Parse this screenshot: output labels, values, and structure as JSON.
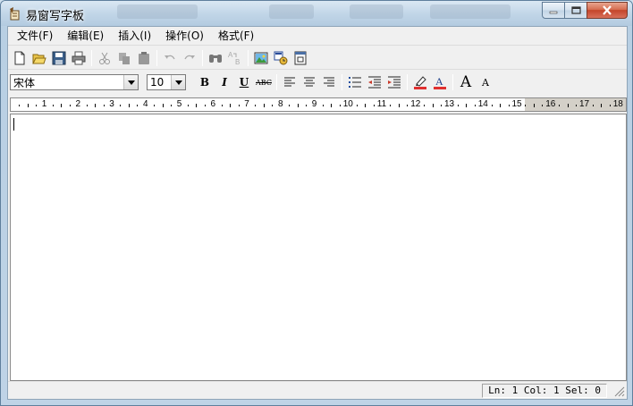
{
  "window": {
    "title": "易窗写字板",
    "controls": {
      "minimize_icon": "minimize-icon",
      "maximize_icon": "maximize-icon",
      "close_icon": "close-icon"
    }
  },
  "menu": [
    {
      "id": "file",
      "label": "文件(F)"
    },
    {
      "id": "edit",
      "label": "编辑(E)"
    },
    {
      "id": "insert",
      "label": "插入(I)"
    },
    {
      "id": "operate",
      "label": "操作(O)"
    },
    {
      "id": "format",
      "label": "格式(F)"
    }
  ],
  "toolbar_standard": [
    "new-document-icon",
    "open-folder-icon",
    "save-icon",
    "print-icon",
    "cut-icon",
    "copy-icon",
    "paste-icon",
    "undo-icon",
    "redo-icon",
    "find-icon",
    "replace-icon",
    "insert-picture-icon",
    "insert-object-icon",
    "insert-datetime-icon"
  ],
  "format_bar": {
    "font_name": "宋体",
    "font_size": "10",
    "bold": "B",
    "italic": "I",
    "underline": "U",
    "strikethrough": "ABC",
    "grow_font": "A",
    "shrink_font": "A"
  },
  "ruler": {
    "numbers": [
      "1",
      "2",
      "3",
      "4",
      "5",
      "6",
      "7",
      "8",
      "9",
      "10",
      "11",
      "12",
      "13",
      "14",
      "15",
      "16",
      "17",
      "18"
    ]
  },
  "editor": {
    "content": ""
  },
  "status": {
    "position": "Ln: 1 Col: 1 Sel: 0"
  },
  "colors": {
    "highlight_bar": "#e03030",
    "font_color_bar": "#e03030",
    "title_gradient": "#c2d6e8"
  }
}
